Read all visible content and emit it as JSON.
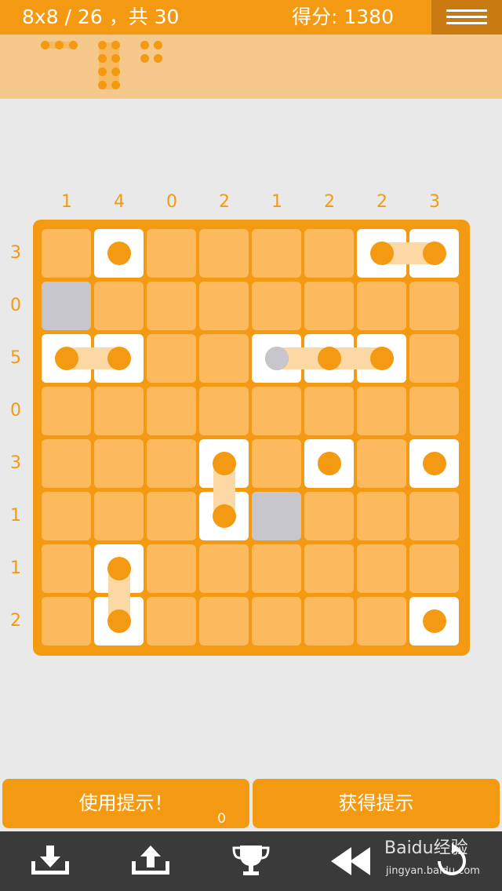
{
  "header": {
    "level_text": "8x8 / 26 ，共 30",
    "score_text": "得分: 1380"
  },
  "colors": {
    "accent": "#f39a12",
    "strip": "#f5c98b",
    "cell": "#fcb95e",
    "ship_cell": "#ffffff",
    "water_cell": "#c6c6cc",
    "background": "#e9e9e9",
    "toolbar": "#3a3a3a"
  },
  "board": {
    "size": 8,
    "col_clues": [
      "1",
      "4",
      "0",
      "2",
      "1",
      "2",
      "2",
      "3"
    ],
    "row_clues": [
      "3",
      "0",
      "5",
      "0",
      "3",
      "1",
      "1",
      "2"
    ],
    "cells": [
      [
        "empty",
        "ship",
        "empty",
        "empty",
        "empty",
        "empty",
        "ship",
        "ship"
      ],
      [
        "water",
        "empty",
        "empty",
        "empty",
        "empty",
        "empty",
        "empty",
        "empty"
      ],
      [
        "ship",
        "ship",
        "empty",
        "empty",
        "ship",
        "ship",
        "ship",
        "empty"
      ],
      [
        "empty",
        "empty",
        "empty",
        "empty",
        "empty",
        "empty",
        "empty",
        "empty"
      ],
      [
        "empty",
        "empty",
        "empty",
        "ship",
        "empty",
        "ship",
        "empty",
        "ship"
      ],
      [
        "empty",
        "empty",
        "empty",
        "ship",
        "water",
        "empty",
        "empty",
        "empty"
      ],
      [
        "empty",
        "ship",
        "empty",
        "empty",
        "empty",
        "empty",
        "empty",
        "empty"
      ],
      [
        "empty",
        "ship",
        "empty",
        "empty",
        "empty",
        "empty",
        "empty",
        "ship"
      ]
    ],
    "gray_pegs": [
      [
        2,
        4
      ]
    ]
  },
  "buttons": {
    "use_hint_label": "使用提示！",
    "hint_count": "0",
    "get_hint_label": "获得提示"
  },
  "toolbar": {
    "icons": [
      "download-icon",
      "upload-icon",
      "trophy-icon",
      "rewind-icon",
      "restart-icon"
    ],
    "watermark_main": "Baidu经验",
    "watermark_sub": "jingyan.baidu.com"
  }
}
